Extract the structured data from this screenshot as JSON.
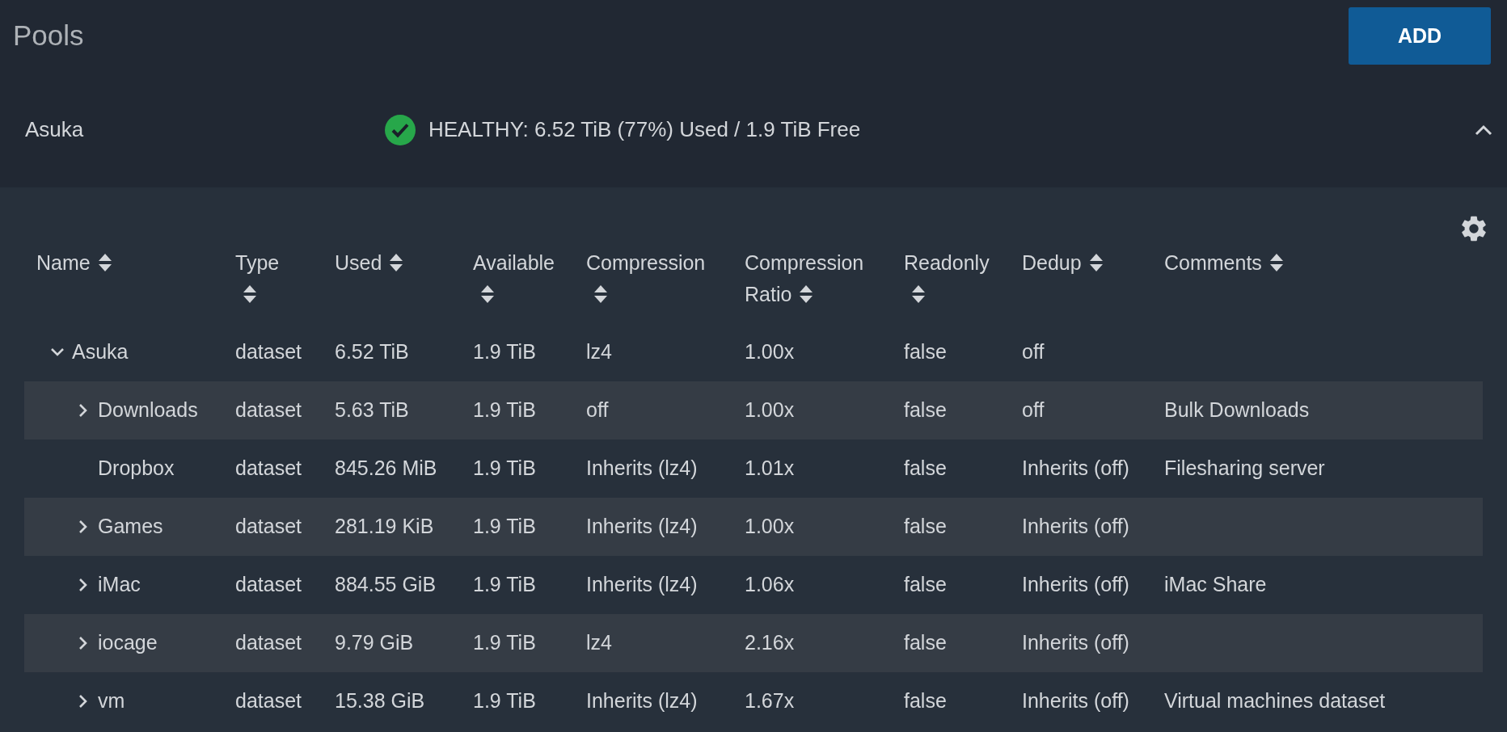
{
  "page": {
    "title": "Pools",
    "add_button": "ADD"
  },
  "pool": {
    "name": "Asuka",
    "status": "HEALTHY: 6.52 TiB (77%) Used / 1.9 TiB Free",
    "expanded": true
  },
  "table": {
    "columns": [
      "Name",
      "Type",
      "Used",
      "Available",
      "Compression",
      "Compression Ratio",
      "Readonly",
      "Dedup",
      "Comments"
    ],
    "rows": [
      {
        "name": "Asuka",
        "kind": "folder",
        "expanded": true,
        "type": "dataset",
        "used": "6.52 TiB",
        "available": "1.9 TiB",
        "compression": "lz4",
        "compression_ratio": "1.00x",
        "readonly": "false",
        "dedup": "off",
        "children": [
          {
            "name": "Downloads",
            "kind": "folder",
            "expanded": false,
            "type": "dataset",
            "used": "5.63 TiB",
            "available": "1.9 TiB",
            "compression": "off",
            "compression_ratio": "1.00x",
            "readonly": "false",
            "dedup": "off",
            "comments": "Bulk Downloads"
          },
          {
            "name": "Dropbox",
            "kind": "leaf",
            "type": "dataset",
            "used": "845.26 MiB",
            "available": "1.9 TiB",
            "compression": "Inherits (lz4)",
            "compression_ratio": "1.01x",
            "readonly": "false",
            "dedup": "Inherits (off)",
            "comments": "Filesharing server"
          },
          {
            "name": "Games",
            "kind": "folder",
            "expanded": false,
            "type": "dataset",
            "used": "281.19 KiB",
            "available": "1.9 TiB",
            "compression": "Inherits (lz4)",
            "compression_ratio": "1.00x",
            "readonly": "false",
            "dedup": "Inherits (off)"
          },
          {
            "name": "iMac",
            "kind": "folder",
            "expanded": false,
            "type": "dataset",
            "used": "884.55 GiB",
            "available": "1.9 TiB",
            "compression": "Inherits (lz4)",
            "compression_ratio": "1.06x",
            "readonly": "false",
            "dedup": "Inherits (off)",
            "comments": "iMac Share"
          },
          {
            "name": "iocage",
            "kind": "folder",
            "expanded": false,
            "type": "dataset",
            "used": "9.79 GiB",
            "available": "1.9 TiB",
            "compression": "lz4",
            "compression_ratio": "2.16x",
            "readonly": "false",
            "dedup": "Inherits (off)"
          },
          {
            "name": "vm",
            "kind": "folder",
            "expanded": false,
            "type": "dataset",
            "used": "15.38 GiB",
            "available": "1.9 TiB",
            "compression": "Inherits (lz4)",
            "compression_ratio": "1.67x",
            "readonly": "false",
            "dedup": "Inherits (off)",
            "comments": "Virtual machines dataset"
          }
        ]
      }
    ]
  }
}
